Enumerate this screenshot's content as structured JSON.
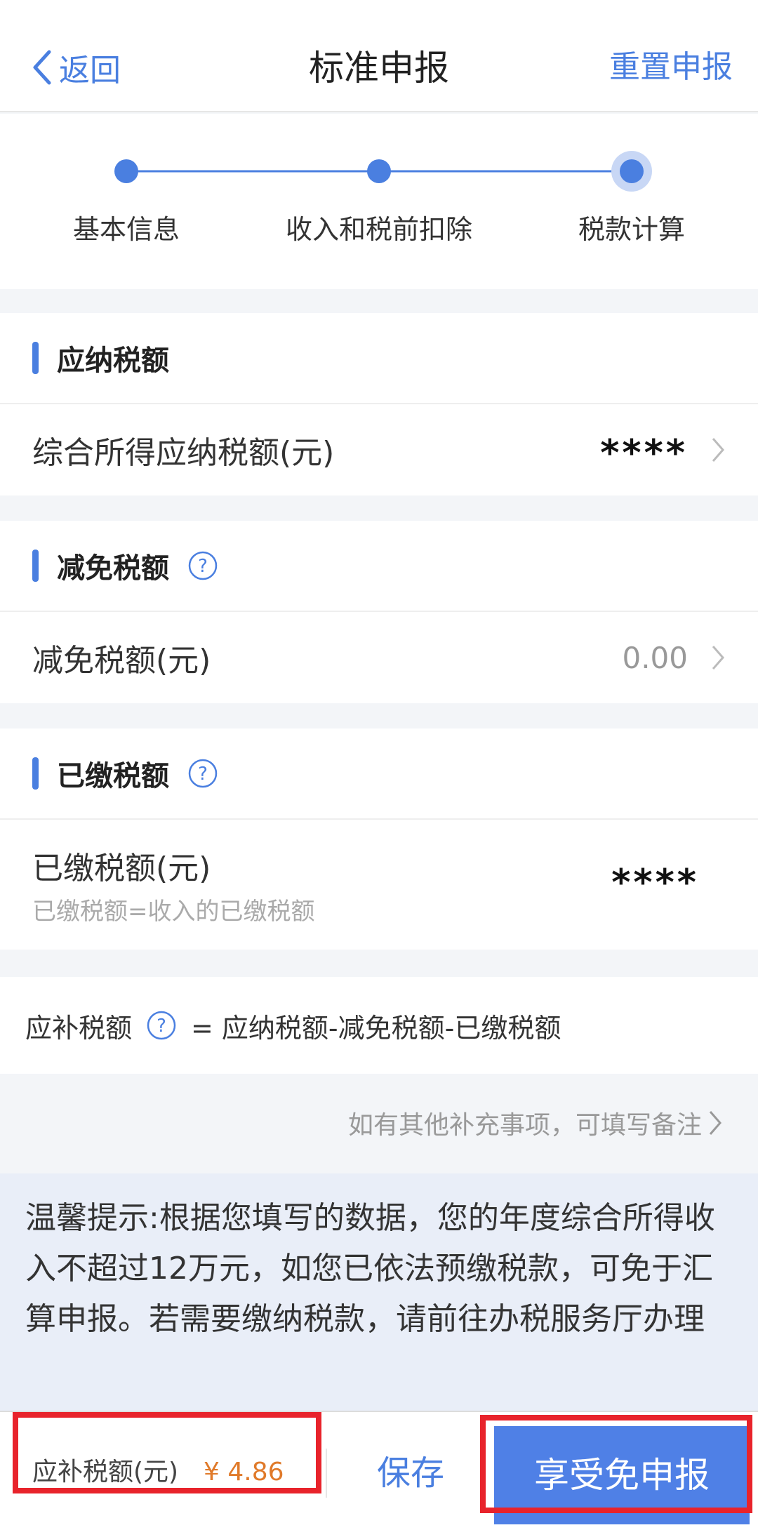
{
  "nav": {
    "back_label": "返回",
    "title": "标准申报",
    "reset_label": "重置申报"
  },
  "steps": [
    {
      "label": "基本信息",
      "state": "done"
    },
    {
      "label": "收入和税前扣除",
      "state": "done"
    },
    {
      "label": "税款计算",
      "state": "current"
    }
  ],
  "sections": {
    "payable": {
      "title": "应纳税额",
      "row_label": "综合所得应纳税额(元)",
      "row_value": "****"
    },
    "reduction": {
      "title": "减免税额",
      "row_label": "减免税额(元)",
      "row_value": "0.00"
    },
    "paid": {
      "title": "已缴税额",
      "row_label": "已缴税额(元)",
      "row_sub": "已缴税额=收入的已缴税额",
      "row_value": "****"
    }
  },
  "formula": {
    "label": "应补税额",
    "expr": "= 应纳税额-减免税额-已缴税额"
  },
  "remark_link": "如有其他补充事项，可填写备注",
  "tip": "温馨提示:根据您填写的数据，您的年度综合所得收入不超过12万元，如您已依法预缴税款，可免于汇算申报。若需要缴纳税款，请前往办税服务厅办理",
  "bottom": {
    "label": "应补税额(元)",
    "amount": "¥ 4.86",
    "save_label": "保存",
    "submit_label": "享受免申报"
  },
  "colors": {
    "accent": "#4a7fe0",
    "submit_bg": "#4f80e6",
    "amount": "#e07a2a",
    "highlight": "#e8232b",
    "tip_bg": "#e9eef8"
  },
  "icons": [
    "chevron-left-icon",
    "question-circle-icon",
    "chevron-right-icon"
  ]
}
